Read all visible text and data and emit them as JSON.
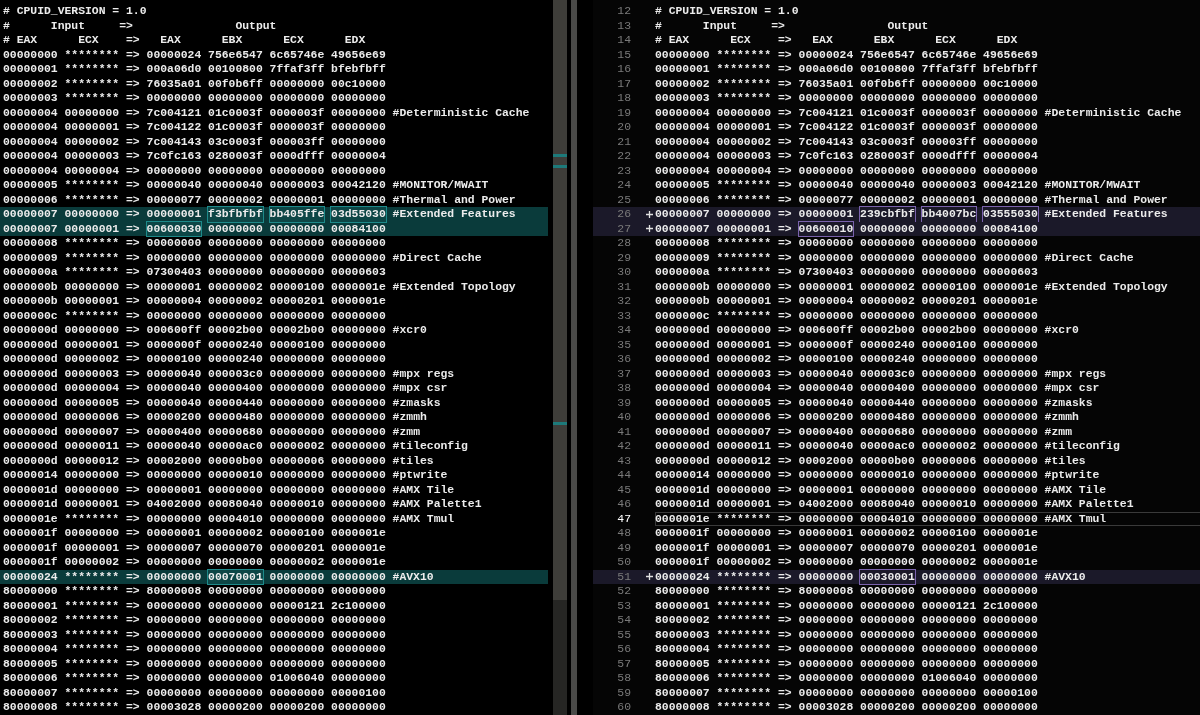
{
  "left_pane": {
    "rows": [
      {
        "text": "# CPUID_VERSION = 1.0",
        "changed": false
      },
      {
        "text": "#      Input     =>               Output",
        "changed": false
      },
      {
        "text": "# EAX      ECX    =>   EAX      EBX      ECX      EDX",
        "changed": false
      },
      {
        "text": "00000000 ******** => 00000024 756e6547 6c65746e 49656e69",
        "changed": false
      },
      {
        "text": "00000001 ******** => 000a06d0 00100800 7ffaf3ff bfebfbff",
        "changed": false
      },
      {
        "text": "00000002 ******** => 76035a01 00f0b6ff 00000000 00c10000",
        "changed": false
      },
      {
        "text": "00000003 ******** => 00000000 00000000 00000000 00000000",
        "changed": false
      },
      {
        "text": "00000004 00000000 => 7c004121 01c0003f 0000003f 00000000 #Deterministic Cache",
        "changed": false
      },
      {
        "text": "00000004 00000001 => 7c004122 01c0003f 0000003f 00000000",
        "changed": false
      },
      {
        "text": "00000004 00000002 => 7c004143 03c0003f 000003ff 00000000",
        "changed": false
      },
      {
        "text": "00000004 00000003 => 7c0fc163 0280003f 0000dfff 00000004",
        "changed": false
      },
      {
        "text": "00000004 00000004 => 00000000 00000000 00000000 00000000",
        "changed": false
      },
      {
        "text": "00000005 ******** => 00000040 00000040 00000003 00042120 #MONITOR/MWAIT",
        "changed": false
      },
      {
        "text": "00000006 ******** => 00000077 00000002 00000001 00000000 #Thermal and Power",
        "changed": false
      },
      {
        "changed": true,
        "segments": [
          {
            "text": "00000007 00000000 => 00000001",
            "changed": false
          },
          {
            "text": "f3bfbfbf",
            "changed": true
          },
          {
            "text": "bb405ffe",
            "changed": true
          },
          {
            "text": "03d55030",
            "changed": true
          },
          {
            "text": "#Extended Features",
            "changed": false
          }
        ]
      },
      {
        "changed": true,
        "segments": [
          {
            "text": "00000007 00000001 =>",
            "changed": false
          },
          {
            "text": "00600030",
            "changed": true
          },
          {
            "text": "00000000 00000000 00084100",
            "changed": false
          }
        ]
      },
      {
        "text": "00000008 ******** => 00000000 00000000 00000000 00000000",
        "changed": false
      },
      {
        "text": "00000009 ******** => 00000000 00000000 00000000 00000000 #Direct Cache",
        "changed": false
      },
      {
        "text": "0000000a ******** => 07300403 00000000 00000000 00000603",
        "changed": false
      },
      {
        "text": "0000000b 00000000 => 00000001 00000002 00000100 0000001e #Extended Topology",
        "changed": false
      },
      {
        "text": "0000000b 00000001 => 00000004 00000002 00000201 0000001e",
        "changed": false
      },
      {
        "text": "0000000c ******** => 00000000 00000000 00000000 00000000",
        "changed": false
      },
      {
        "text": "0000000d 00000000 => 000600ff 00002b00 00002b00 00000000 #xcr0",
        "changed": false
      },
      {
        "text": "0000000d 00000001 => 0000000f 00000240 00000100 00000000",
        "changed": false
      },
      {
        "text": "0000000d 00000002 => 00000100 00000240 00000000 00000000",
        "changed": false
      },
      {
        "text": "0000000d 00000003 => 00000040 000003c0 00000000 00000000 #mpx regs",
        "changed": false
      },
      {
        "text": "0000000d 00000004 => 00000040 00000400 00000000 00000000 #mpx csr",
        "changed": false
      },
      {
        "text": "0000000d 00000005 => 00000040 00000440 00000000 00000000 #zmasks",
        "changed": false
      },
      {
        "text": "0000000d 00000006 => 00000200 00000480 00000000 00000000 #zmmh",
        "changed": false
      },
      {
        "text": "0000000d 00000007 => 00000400 00000680 00000000 00000000 #zmm",
        "changed": false
      },
      {
        "text": "0000000d 00000011 => 00000040 00000ac0 00000002 00000000 #tileconfig",
        "changed": false
      },
      {
        "text": "0000000d 00000012 => 00002000 00000b00 00000006 00000000 #tiles",
        "changed": false
      },
      {
        "text": "00000014 00000000 => 00000000 00000010 00000000 00000000 #ptwrite",
        "changed": false
      },
      {
        "text": "0000001d 00000000 => 00000001 00000000 00000000 00000000 #AMX Tile",
        "changed": false
      },
      {
        "text": "0000001d 00000001 => 04002000 00080040 00000010 00000000 #AMX Palette1",
        "changed": false
      },
      {
        "text": "0000001e ******** => 00000000 00004010 00000000 00000000 #AMX Tmul",
        "changed": false
      },
      {
        "text": "0000001f 00000000 => 00000001 00000002 00000100 0000001e",
        "changed": false
      },
      {
        "text": "0000001f 00000001 => 00000007 00000070 00000201 0000001e",
        "changed": false
      },
      {
        "text": "0000001f 00000002 => 00000000 00000000 00000002 0000001e",
        "changed": false
      },
      {
        "changed": true,
        "segments": [
          {
            "text": "00000024 ******** => 00000000",
            "changed": false
          },
          {
            "text": "00070001",
            "changed": true
          },
          {
            "text": "00000000 00000000 #AVX10",
            "changed": false
          }
        ]
      },
      {
        "text": "80000000 ******** => 80000008 00000000 00000000 00000000",
        "changed": false
      },
      {
        "text": "80000001 ******** => 00000000 00000000 00000121 2c100000",
        "changed": false
      },
      {
        "text": "80000002 ******** => 00000000 00000000 00000000 00000000",
        "changed": false
      },
      {
        "text": "80000003 ******** => 00000000 00000000 00000000 00000000",
        "changed": false
      },
      {
        "text": "80000004 ******** => 00000000 00000000 00000000 00000000",
        "changed": false
      },
      {
        "text": "80000005 ******** => 00000000 00000000 00000000 00000000",
        "changed": false
      },
      {
        "text": "80000006 ******** => 00000000 00000000 01006040 00000000",
        "changed": false
      },
      {
        "text": "80000007 ******** => 00000000 00000000 00000000 00000100",
        "changed": false
      },
      {
        "text": "80000008 ******** => 00003028 00000200 00000200 00000000",
        "changed": false
      }
    ]
  },
  "right_pane": {
    "rows": [
      {
        "number": "12",
        "text": "# CPUID_VERSION = 1.0",
        "changed": false,
        "current": false
      },
      {
        "number": "13",
        "text": "#      Input     =>               Output",
        "changed": false,
        "current": false
      },
      {
        "number": "14",
        "text": "# EAX      ECX    =>   EAX      EBX      ECX      EDX",
        "changed": false,
        "current": false
      },
      {
        "number": "15",
        "text": "00000000 ******** => 00000024 756e6547 6c65746e 49656e69",
        "changed": false,
        "current": false
      },
      {
        "number": "16",
        "text": "00000001 ******** => 000a06d0 00100800 7ffaf3ff bfebfbff",
        "changed": false,
        "current": false
      },
      {
        "number": "17",
        "text": "00000002 ******** => 76035a01 00f0b6ff 00000000 00c10000",
        "changed": false,
        "current": false
      },
      {
        "number": "18",
        "text": "00000003 ******** => 00000000 00000000 00000000 00000000",
        "changed": false,
        "current": false
      },
      {
        "number": "19",
        "text": "00000004 00000000 => 7c004121 01c0003f 0000003f 00000000 #Deterministic Cache",
        "changed": false,
        "current": false
      },
      {
        "number": "20",
        "text": "00000004 00000001 => 7c004122 01c0003f 0000003f 00000000",
        "changed": false,
        "current": false
      },
      {
        "number": "21",
        "text": "00000004 00000002 => 7c004143 03c0003f 000003ff 00000000",
        "changed": false,
        "current": false
      },
      {
        "number": "22",
        "text": "00000004 00000003 => 7c0fc163 0280003f 0000dfff 00000004",
        "changed": false,
        "current": false
      },
      {
        "number": "23",
        "text": "00000004 00000004 => 00000000 00000000 00000000 00000000",
        "changed": false,
        "current": false
      },
      {
        "number": "24",
        "text": "00000005 ******** => 00000040 00000040 00000003 00042120 #MONITOR/MWAIT",
        "changed": false,
        "current": false
      },
      {
        "number": "25",
        "text": "00000006 ******** => 00000077 00000002 00000001 00000000 #Thermal and Power",
        "changed": false,
        "current": false
      },
      {
        "number": "26",
        "changed": true,
        "current": false,
        "segments": [
          {
            "text": "00000007 00000000 => 00000001",
            "changed": false
          },
          {
            "text": "239cbfbf",
            "changed": true
          },
          {
            "text": "bb4007bc",
            "changed": true
          },
          {
            "text": "03555030",
            "changed": true
          },
          {
            "text": "#Extended Features",
            "changed": false
          }
        ]
      },
      {
        "number": "27",
        "changed": true,
        "current": false,
        "segments": [
          {
            "text": "00000007 00000001 =>",
            "changed": false
          },
          {
            "text": "00600010",
            "changed": true
          },
          {
            "text": "00000000 00000000 00084100",
            "changed": false
          }
        ]
      },
      {
        "number": "28",
        "text": "00000008 ******** => 00000000 00000000 00000000 00000000",
        "changed": false,
        "current": false
      },
      {
        "number": "29",
        "text": "00000009 ******** => 00000000 00000000 00000000 00000000 #Direct Cache",
        "changed": false,
        "current": false
      },
      {
        "number": "30",
        "text": "0000000a ******** => 07300403 00000000 00000000 00000603",
        "changed": false,
        "current": false
      },
      {
        "number": "31",
        "text": "0000000b 00000000 => 00000001 00000002 00000100 0000001e #Extended Topology",
        "changed": false,
        "current": false
      },
      {
        "number": "32",
        "text": "0000000b 00000001 => 00000004 00000002 00000201 0000001e",
        "changed": false,
        "current": false
      },
      {
        "number": "33",
        "text": "0000000c ******** => 00000000 00000000 00000000 00000000",
        "changed": false,
        "current": false
      },
      {
        "number": "34",
        "text": "0000000d 00000000 => 000600ff 00002b00 00002b00 00000000 #xcr0",
        "changed": false,
        "current": false
      },
      {
        "number": "35",
        "text": "0000000d 00000001 => 0000000f 00000240 00000100 00000000",
        "changed": false,
        "current": false
      },
      {
        "number": "36",
        "text": "0000000d 00000002 => 00000100 00000240 00000000 00000000",
        "changed": false,
        "current": false
      },
      {
        "number": "37",
        "text": "0000000d 00000003 => 00000040 000003c0 00000000 00000000 #mpx regs",
        "changed": false,
        "current": false
      },
      {
        "number": "38",
        "text": "0000000d 00000004 => 00000040 00000400 00000000 00000000 #mpx csr",
        "changed": false,
        "current": false
      },
      {
        "number": "39",
        "text": "0000000d 00000005 => 00000040 00000440 00000000 00000000 #zmasks",
        "changed": false,
        "current": false
      },
      {
        "number": "40",
        "text": "0000000d 00000006 => 00000200 00000480 00000000 00000000 #zmmh",
        "changed": false,
        "current": false
      },
      {
        "number": "41",
        "text": "0000000d 00000007 => 00000400 00000680 00000000 00000000 #zmm",
        "changed": false,
        "current": false
      },
      {
        "number": "42",
        "text": "0000000d 00000011 => 00000040 00000ac0 00000002 00000000 #tileconfig",
        "changed": false,
        "current": false
      },
      {
        "number": "43",
        "text": "0000000d 00000012 => 00002000 00000b00 00000006 00000000 #tiles",
        "changed": false,
        "current": false
      },
      {
        "number": "44",
        "text": "00000014 00000000 => 00000000 00000010 00000000 00000000 #ptwrite",
        "changed": false,
        "current": false
      },
      {
        "number": "45",
        "text": "0000001d 00000000 => 00000001 00000000 00000000 00000000 #AMX Tile",
        "changed": false,
        "current": false
      },
      {
        "number": "46",
        "text": "0000001d 00000001 => 04002000 00080040 00000010 00000000 #AMX Palette1",
        "changed": false,
        "current": false
      },
      {
        "number": "47",
        "text": "0000001e ******** => 00000000 00004010 00000000 00000000 #AMX Tmul",
        "changed": false,
        "current": true
      },
      {
        "number": "48",
        "text": "0000001f 00000000 => 00000001 00000002 00000100 0000001e",
        "changed": false,
        "current": false
      },
      {
        "number": "49",
        "text": "0000001f 00000001 => 00000007 00000070 00000201 0000001e",
        "changed": false,
        "current": false
      },
      {
        "number": "50",
        "text": "0000001f 00000002 => 00000000 00000000 00000002 0000001e",
        "changed": false,
        "current": false
      },
      {
        "number": "51",
        "changed": true,
        "current": false,
        "segments": [
          {
            "text": "00000024 ******** => 00000000",
            "changed": false
          },
          {
            "text": "00030001",
            "changed": true
          },
          {
            "text": "00000000 00000000 #AVX10",
            "changed": false
          }
        ]
      },
      {
        "number": "52",
        "text": "80000000 ******** => 80000008 00000000 00000000 00000000",
        "changed": false,
        "current": false
      },
      {
        "number": "53",
        "text": "80000001 ******** => 00000000 00000000 00000121 2c100000",
        "changed": false,
        "current": false
      },
      {
        "number": "54",
        "text": "80000002 ******** => 00000000 00000000 00000000 00000000",
        "changed": false,
        "current": false
      },
      {
        "number": "55",
        "text": "80000003 ******** => 00000000 00000000 00000000 00000000",
        "changed": false,
        "current": false
      },
      {
        "number": "56",
        "text": "80000004 ******** => 00000000 00000000 00000000 00000000",
        "changed": false,
        "current": false
      },
      {
        "number": "57",
        "text": "80000005 ******** => 00000000 00000000 00000000 00000000",
        "changed": false,
        "current": false
      },
      {
        "number": "58",
        "text": "80000006 ******** => 00000000 00000000 01006040 00000000",
        "changed": false,
        "current": false
      },
      {
        "number": "59",
        "text": "80000007 ******** => 00000000 00000000 00000000 00000100",
        "changed": false,
        "current": false
      },
      {
        "number": "60",
        "text": "80000008 ******** => 00003028 00000200 00000200 00000000",
        "changed": false,
        "current": false
      }
    ]
  }
}
